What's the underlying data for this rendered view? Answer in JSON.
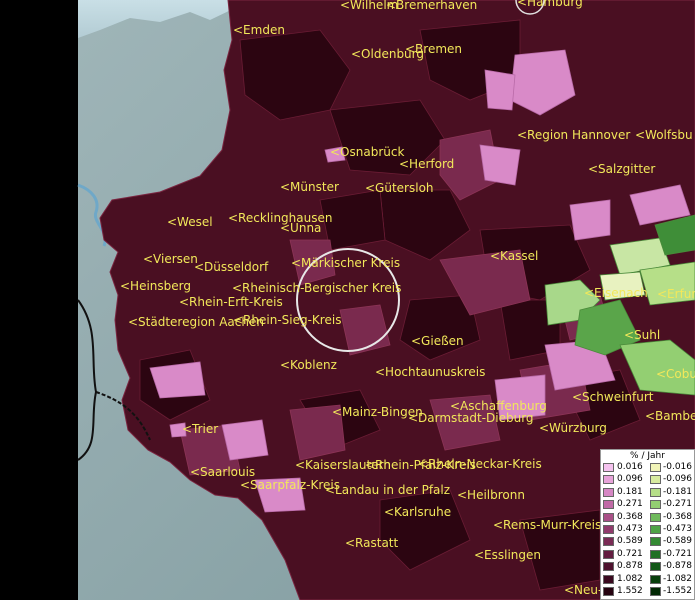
{
  "legend": {
    "title": "% / Jahr",
    "positive": [
      {
        "value": "0.016",
        "color": "#f4c2ee"
      },
      {
        "value": "0.096",
        "color": "#e7a3d9"
      },
      {
        "value": "0.181",
        "color": "#d687c4"
      },
      {
        "value": "0.271",
        "color": "#c06aa6"
      },
      {
        "value": "0.368",
        "color": "#a95087"
      },
      {
        "value": "0.473",
        "color": "#913b6c"
      },
      {
        "value": "0.589",
        "color": "#7a2b55"
      },
      {
        "value": "0.721",
        "color": "#631d40"
      },
      {
        "value": "0.878",
        "color": "#4e122e"
      },
      {
        "value": "1.082",
        "color": "#3a0a1f"
      },
      {
        "value": "1.552",
        "color": "#260310"
      }
    ],
    "negative": [
      {
        "value": "-0.016",
        "color": "#f1f4b8"
      },
      {
        "value": "-0.096",
        "color": "#d8ec9f"
      },
      {
        "value": "-0.181",
        "color": "#b6df88"
      },
      {
        "value": "-0.271",
        "color": "#93cf72"
      },
      {
        "value": "-0.368",
        "color": "#6fba5c"
      },
      {
        "value": "-0.473",
        "color": "#4ea346"
      },
      {
        "value": "-0.589",
        "color": "#348a33"
      },
      {
        "value": "-0.721",
        "color": "#207024"
      },
      {
        "value": "-0.878",
        "color": "#125717"
      },
      {
        "value": "-1.082",
        "color": "#083f0c"
      },
      {
        "value": "-1.552",
        "color": "#022904"
      }
    ]
  },
  "places": [
    {
      "id": "wilhelmshaven",
      "text": "<Wilhelm"
    },
    {
      "id": "bremerhaven",
      "text": "<Bremerhaven"
    },
    {
      "id": "hamburg",
      "text": "<Hamburg"
    },
    {
      "id": "emden",
      "text": "<Emden"
    },
    {
      "id": "oldenburg",
      "text": "<Oldenburg"
    },
    {
      "id": "bremen",
      "text": "<Bremen"
    },
    {
      "id": "region-hannover",
      "text": "<Region Hannover"
    },
    {
      "id": "wolfsburg",
      "text": "<Wolfsbu"
    },
    {
      "id": "osnabrueck",
      "text": "<Osnabrück"
    },
    {
      "id": "herford",
      "text": "<Herford"
    },
    {
      "id": "salzgitter",
      "text": "<Salzgitter"
    },
    {
      "id": "muenster",
      "text": "<Münster"
    },
    {
      "id": "guetersloh",
      "text": "<Gütersloh"
    },
    {
      "id": "wesel",
      "text": "<Wesel"
    },
    {
      "id": "recklinghausen",
      "text": "<Recklinghausen"
    },
    {
      "id": "unna",
      "text": "<Unna"
    },
    {
      "id": "kassel",
      "text": "<Kassel"
    },
    {
      "id": "viersen",
      "text": "<Viersen"
    },
    {
      "id": "duesseldorf",
      "text": "<Düsseldorf"
    },
    {
      "id": "maerkischer-kreis",
      "text": "<Märkischer Kreis"
    },
    {
      "id": "heinsberg",
      "text": "<Heinsberg"
    },
    {
      "id": "rheinisch-bergischer-kreis",
      "text": "<Rheinisch-Bergischer Kreis"
    },
    {
      "id": "eisenach",
      "text": "<Eisenach"
    },
    {
      "id": "erfurt",
      "text": "<Erfurt"
    },
    {
      "id": "rhein-erft-kreis",
      "text": "<Rhein-Erft-Kreis"
    },
    {
      "id": "staedteregion-aachen",
      "text": "<Städteregion Aachen"
    },
    {
      "id": "rhein-sieg-kreis",
      "text": "<Rhein-Sieg-Kreis"
    },
    {
      "id": "suhl",
      "text": "<Suhl"
    },
    {
      "id": "giessen",
      "text": "<Gießen"
    },
    {
      "id": "koblenz",
      "text": "<Koblenz"
    },
    {
      "id": "hochtaunuskreis",
      "text": "<Hochtaunuskreis"
    },
    {
      "id": "coburg",
      "text": "<Cobu"
    },
    {
      "id": "schweinfurt",
      "text": "<Schweinfurt"
    },
    {
      "id": "aschaffenburg",
      "text": "<Aschaffenburg"
    },
    {
      "id": "mainz-bingen",
      "text": "<Mainz-Bingen"
    },
    {
      "id": "darmstadt-dieburg",
      "text": "<Darmstadt-Dieburg"
    },
    {
      "id": "bamberg",
      "text": "<Bambe"
    },
    {
      "id": "trier",
      "text": "<Trier"
    },
    {
      "id": "wuerzburg",
      "text": "<Würzburg"
    },
    {
      "id": "kaiserslautern",
      "text": "<Kaiserslautern"
    },
    {
      "id": "rhein-pfalz-kreis",
      "text": "<Rhein-Pfalz-Kreis"
    },
    {
      "id": "neckar-kreis",
      "text": "<Rhein-Neckar-Kreis"
    },
    {
      "id": "saarlouis",
      "text": "<Saarlouis"
    },
    {
      "id": "saarpfalz-kreis",
      "text": "<Saarpfalz-Kreis"
    },
    {
      "id": "landau",
      "text": "<Landau in der Pfalz"
    },
    {
      "id": "heilbronn",
      "text": "<Heilbronn"
    },
    {
      "id": "karlsruhe",
      "text": "<Karlsruhe"
    },
    {
      "id": "rems-murr-kreis",
      "text": "<Rems-Murr-Kreis"
    },
    {
      "id": "rastatt",
      "text": "<Rastatt"
    },
    {
      "id": "esslingen",
      "text": "<Esslingen"
    },
    {
      "id": "neu",
      "text": "<Neu-"
    }
  ]
}
